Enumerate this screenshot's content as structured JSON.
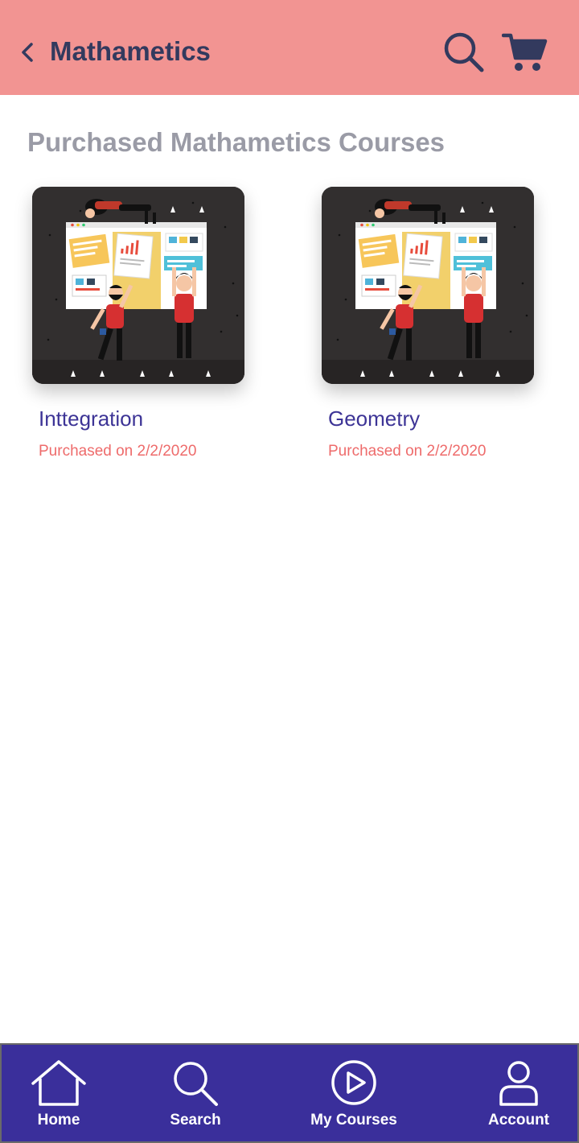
{
  "header": {
    "title": "Mathametics",
    "icons": [
      "back-arrow-icon",
      "search-icon",
      "cart-icon"
    ]
  },
  "section": {
    "heading": "Purchased Mathametics Courses"
  },
  "courses": [
    {
      "title": "Inttegration",
      "purchased": "Purchased on 2/2/2020",
      "thumbnail": "team-whiteboard-illustration"
    },
    {
      "title": "Geometry",
      "purchased": "Purchased on 2/2/2020",
      "thumbnail": "team-whiteboard-illustration"
    }
  ],
  "nav": [
    {
      "label": "Home",
      "icon": "home-icon"
    },
    {
      "label": "Search",
      "icon": "search-icon"
    },
    {
      "label": "My Courses",
      "icon": "play-circle-icon"
    },
    {
      "label": "Account",
      "icon": "user-icon"
    }
  ],
  "colors": {
    "header_bg": "#f29492",
    "header_text": "#333a5e",
    "heading_gray": "#9a9ba6",
    "course_title": "#3d3496",
    "date_text": "#ee6b6b",
    "nav_bg": "#3a2f9b",
    "thumb_bg": "#322f2f"
  }
}
